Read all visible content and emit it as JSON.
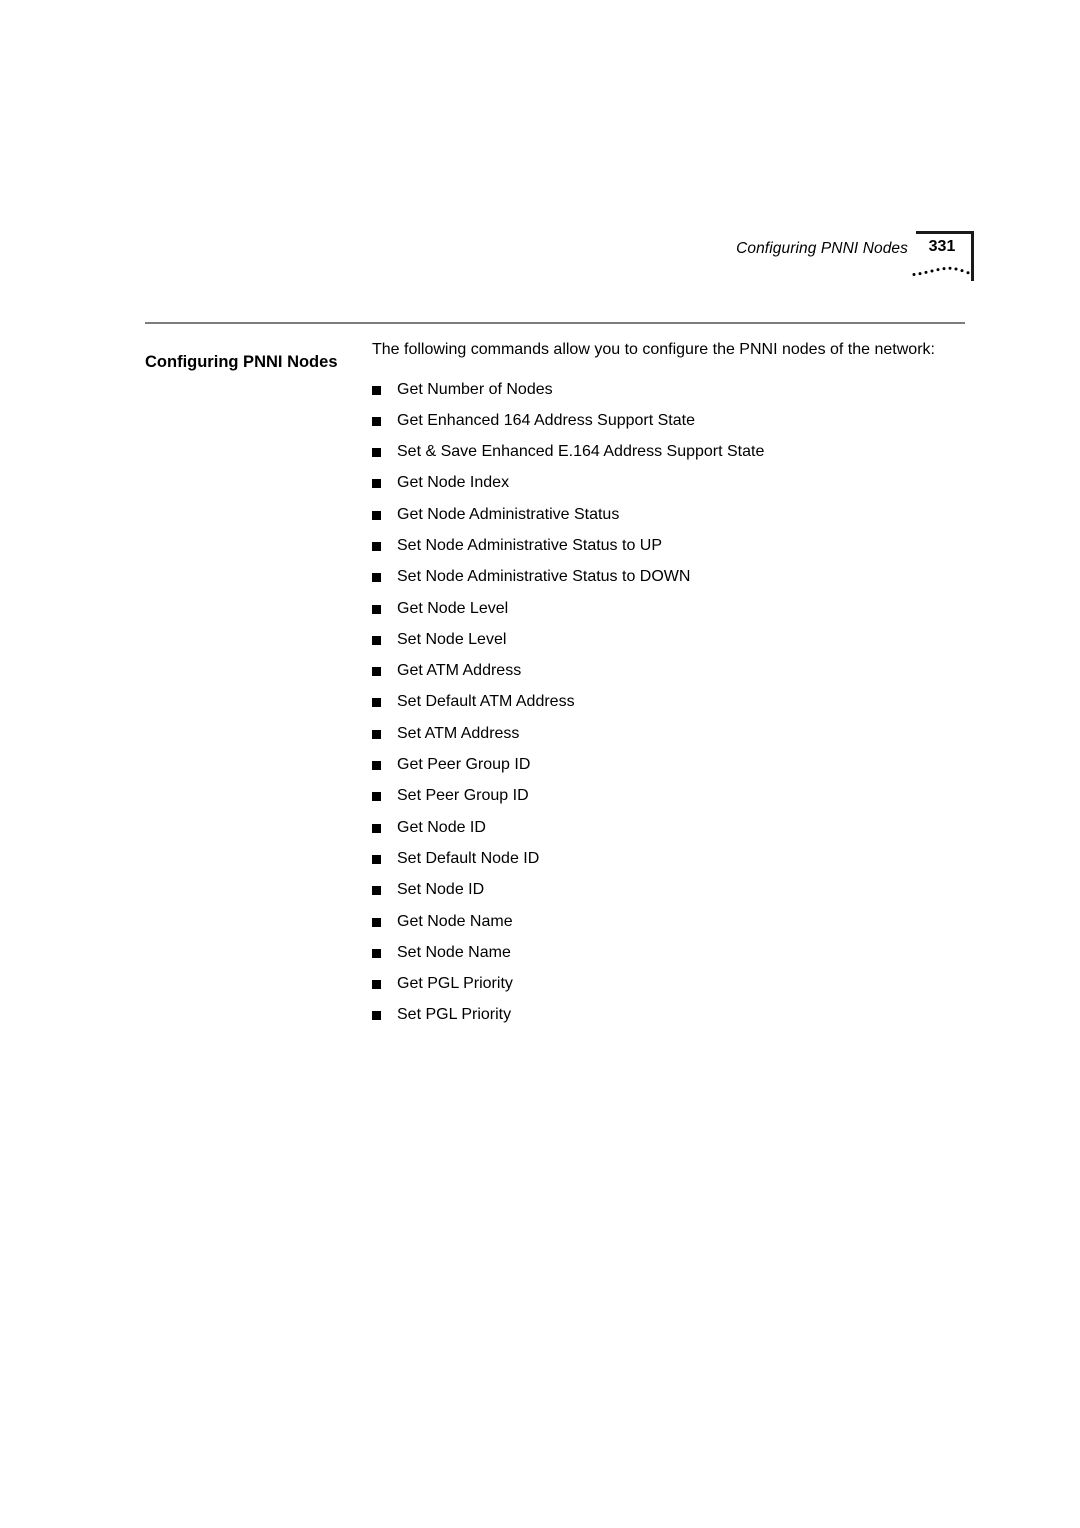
{
  "header": {
    "running_title": "Configuring PNNI Nodes",
    "page_number": "331"
  },
  "section": {
    "heading": "Configuring PNNI Nodes",
    "intro": "The following commands allow you to configure the PNNI nodes of the network:"
  },
  "commands": [
    {
      "label": "Get Number of Nodes"
    },
    {
      "label": "Get Enhanced 164 Address Support State"
    },
    {
      "label": "Set & Save Enhanced E.164 Address Support State"
    },
    {
      "label": "Get Node Index"
    },
    {
      "label": "Get Node Administrative Status"
    },
    {
      "label": "Set Node Administrative Status to UP"
    },
    {
      "label": "Set Node Administrative Status to DOWN"
    },
    {
      "label": "Get Node Level"
    },
    {
      "label": "Set Node Level"
    },
    {
      "label": "Get ATM Address"
    },
    {
      "label": "Set Default ATM Address"
    },
    {
      "label": "Set ATM Address"
    },
    {
      "label": "Get Peer Group ID"
    },
    {
      "label": "Set Peer Group ID"
    },
    {
      "label": "Get Node ID"
    },
    {
      "label": "Set Default Node ID"
    },
    {
      "label": "Set Node ID"
    },
    {
      "label": "Get Node Name"
    },
    {
      "label": "Set Node Name"
    },
    {
      "label": "Get PGL Priority"
    },
    {
      "label": "Set PGL Priority"
    }
  ],
  "colors": {
    "text": "#000000",
    "rule": "#7d7d7d",
    "folio_rule": "#1a1a1a"
  }
}
